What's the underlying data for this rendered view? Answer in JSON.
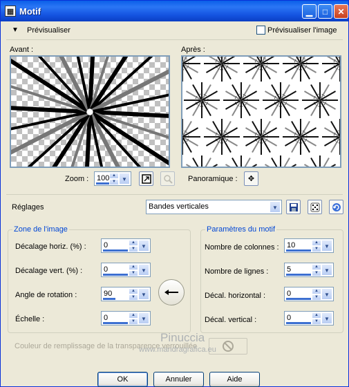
{
  "window": {
    "title": "Motif"
  },
  "preview": {
    "label": "Prévisualiser",
    "preview_image_label": "Prévisualiser l'image",
    "before_label": "Avant :",
    "after_label": "Après :",
    "zoom_label": "Zoom :",
    "zoom_value": "100",
    "pan_label": "Panoramique :"
  },
  "settings": {
    "label": "Réglages",
    "preset_value": "Bandes verticales"
  },
  "image_zone": {
    "title": "Zone de l'image",
    "h_offset_label": "Décalage horiz. (%) :",
    "h_offset_value": "0",
    "v_offset_label": "Décalage vert. (%) :",
    "v_offset_value": "0",
    "rotation_label": "Angle de rotation :",
    "rotation_value": "90",
    "scale_label": "Échelle :",
    "scale_value": "0"
  },
  "pattern": {
    "title": "Paramètres du motif",
    "columns_label": "Nombre de colonnes :",
    "columns_value": "10",
    "rows_label": "Nombre de lignes :",
    "rows_value": "5",
    "h_shift_label": "Décal. horizontal :",
    "h_shift_value": "0",
    "v_shift_label": "Décal. vertical :",
    "v_shift_value": "0"
  },
  "fill": {
    "label": "Couleur de remplissage de la transparence verrouillée"
  },
  "watermark": {
    "line1": "Pinuccia",
    "line2": "www.mandragrafica.eu"
  },
  "buttons": {
    "ok": "OK",
    "cancel": "Annuler",
    "help": "Aide"
  },
  "colors": {
    "accent": "#0046d5",
    "title_blue": "#0a5fe8",
    "close_red": "#c8401e"
  }
}
